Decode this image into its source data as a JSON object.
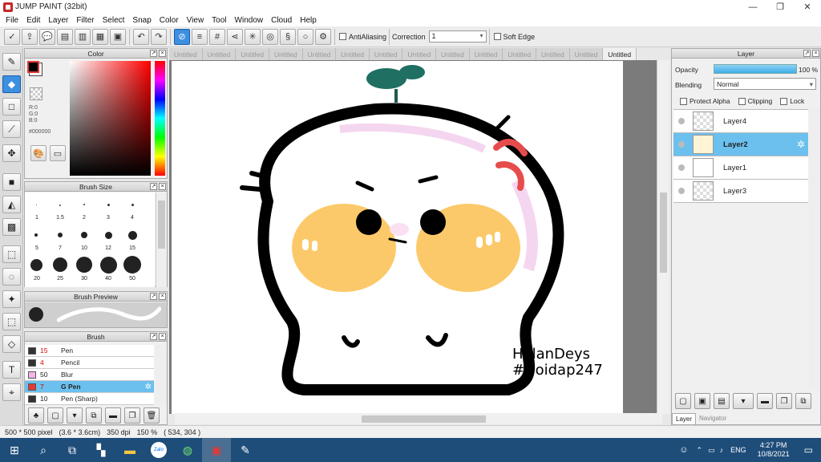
{
  "window": {
    "title": "JUMP PAINT (32bit)"
  },
  "menu": [
    "File",
    "Edit",
    "Layer",
    "Filter",
    "Select",
    "Snap",
    "Color",
    "View",
    "Tool",
    "Window",
    "Cloud",
    "Help"
  ],
  "toolbar": {
    "antialias_label": "AntiAliasing",
    "correction_label": "Correction",
    "correction_value": "1",
    "soft_edge_label": "Soft Edge"
  },
  "color_panel": {
    "title": "Color",
    "r": "R:0",
    "g": "G:0",
    "b": "B:0",
    "hex": "#000000",
    "accent": "#3d8fe0"
  },
  "brush_size_panel": {
    "title": "Brush Size",
    "sizes": [
      "1",
      "1.5",
      "2",
      "3",
      "4",
      "5",
      "7",
      "10",
      "12",
      "15",
      "20",
      "25",
      "30",
      "40",
      "50"
    ]
  },
  "brush_preview_panel": {
    "title": "Brush Preview"
  },
  "brush_panel": {
    "title": "Brush",
    "items": [
      {
        "num": "15",
        "name": "Pen",
        "color": "#333333"
      },
      {
        "num": "4",
        "name": "Pencil",
        "color": "#333333"
      },
      {
        "num": "50",
        "name": "Blur",
        "color": "#f6b4e8"
      },
      {
        "num": "7",
        "name": "G Pen",
        "color": "#e53935"
      },
      {
        "num": "10",
        "name": "Pen (Sharp)",
        "color": "#333333"
      }
    ]
  },
  "tabs": [
    "Untitled",
    "Untitled",
    "Untitled",
    "Untitled",
    "Untitled",
    "Untitled",
    "Untitled",
    "Untitled",
    "Untitled",
    "Untitled",
    "Untitled",
    "Untitled",
    "Untitled",
    "Untitled"
  ],
  "canvas": {
    "watermark_line1": "HelanDeys",
    "watermark_line2": "#Hoidap247"
  },
  "layer_panel": {
    "title": "Layer",
    "opacity_label": "Opacity",
    "opacity_value": "100 %",
    "blending_label": "Blending",
    "blending_value": "Normal",
    "protect_alpha": "Protect Alpha",
    "clipping": "Clipping",
    "lock": "Lock",
    "layers": [
      "Layer4",
      "Layer2",
      "Layer1",
      "Layer3"
    ],
    "bottom_tabs": [
      "Layer",
      "Navigator"
    ]
  },
  "status": {
    "size": "500 * 500 pixel",
    "cm": "(3.6 * 3.6cm)",
    "dpi": "350 dpi",
    "zoom": "150 %",
    "coords": "( 534, 304 )"
  },
  "taskbar": {
    "lang": "ENG",
    "time": "4:27 PM",
    "date": "10/8/2021",
    "zalo": "Zalo"
  }
}
